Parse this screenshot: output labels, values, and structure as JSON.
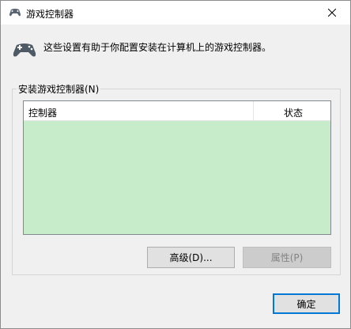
{
  "window": {
    "title": "游戏控制器",
    "title_icon": "gamepad-icon",
    "close_icon": "close-icon"
  },
  "header": {
    "icon": "gamepad-icon",
    "description": "这些设置有助于你配置安装在计算机上的游戏控制器。"
  },
  "installed_group": {
    "label": "安装游戏控制器(N)",
    "columns": [
      "控制器",
      "状态"
    ],
    "rows": []
  },
  "buttons": {
    "advanced_label": "高级(D)...",
    "properties_label": "属性(P)",
    "ok_label": "确定"
  },
  "colors": {
    "list_background": "#c6ecca",
    "default_button_border": "#0078d7"
  }
}
